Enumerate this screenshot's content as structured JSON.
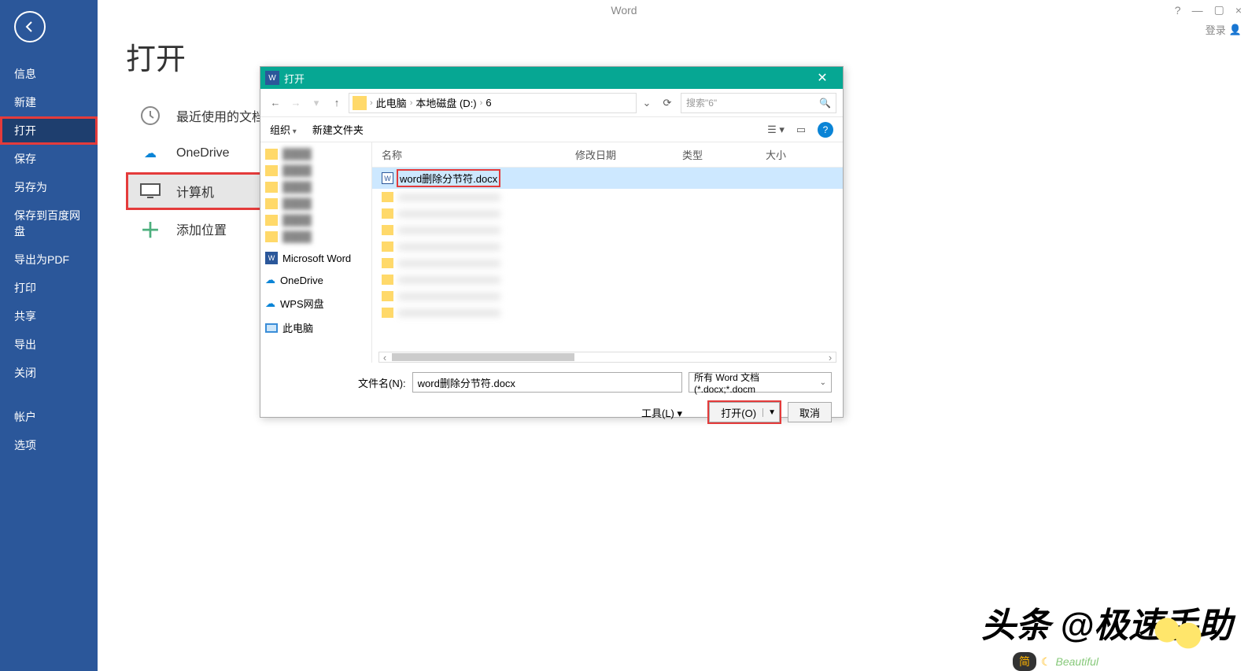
{
  "app_title": "Word",
  "login_label": "登录",
  "window_controls": {
    "help": "?",
    "min": "—",
    "max": "▢",
    "close": "×"
  },
  "sidebar_menu": {
    "info": "信息",
    "new": "新建",
    "open": "打开",
    "save": "保存",
    "saveas": "另存为",
    "save_baidu": "保存到百度网盘",
    "export_pdf": "导出为PDF",
    "print": "打印",
    "share": "共享",
    "export": "导出",
    "close": "关闭",
    "account": "帐户",
    "options": "选项"
  },
  "page_title": "打开",
  "locations": {
    "recent": "最近使用的文档",
    "onedrive": "OneDrive",
    "computer": "计算机",
    "add": "添加位置"
  },
  "dialog": {
    "title": "打开",
    "breadcrumb": {
      "root": "此电脑",
      "drive": "本地磁盘 (D:)",
      "folder": "6"
    },
    "search_placeholder": "搜索\"6\"",
    "toolbar": {
      "organize": "组织",
      "new_folder": "新建文件夹"
    },
    "tree": {
      "ms_word": "Microsoft Word",
      "onedrive": "OneDrive",
      "wps": "WPS网盘",
      "this_pc": "此电脑"
    },
    "columns": {
      "name": "名称",
      "modified": "修改日期",
      "type": "类型",
      "size": "大小"
    },
    "selected_file": "word删除分节符.docx",
    "filename_label": "文件名(N):",
    "filename_value": "word删除分节符.docx",
    "filter": "所有 Word 文档(*.docx;*.docm",
    "tools": "工具(L)",
    "open_btn": "打开(O)",
    "cancel_btn": "取消"
  },
  "watermark": {
    "main": "头条 @极速手助",
    "pill": "简",
    "beautiful": "Beautiful"
  }
}
